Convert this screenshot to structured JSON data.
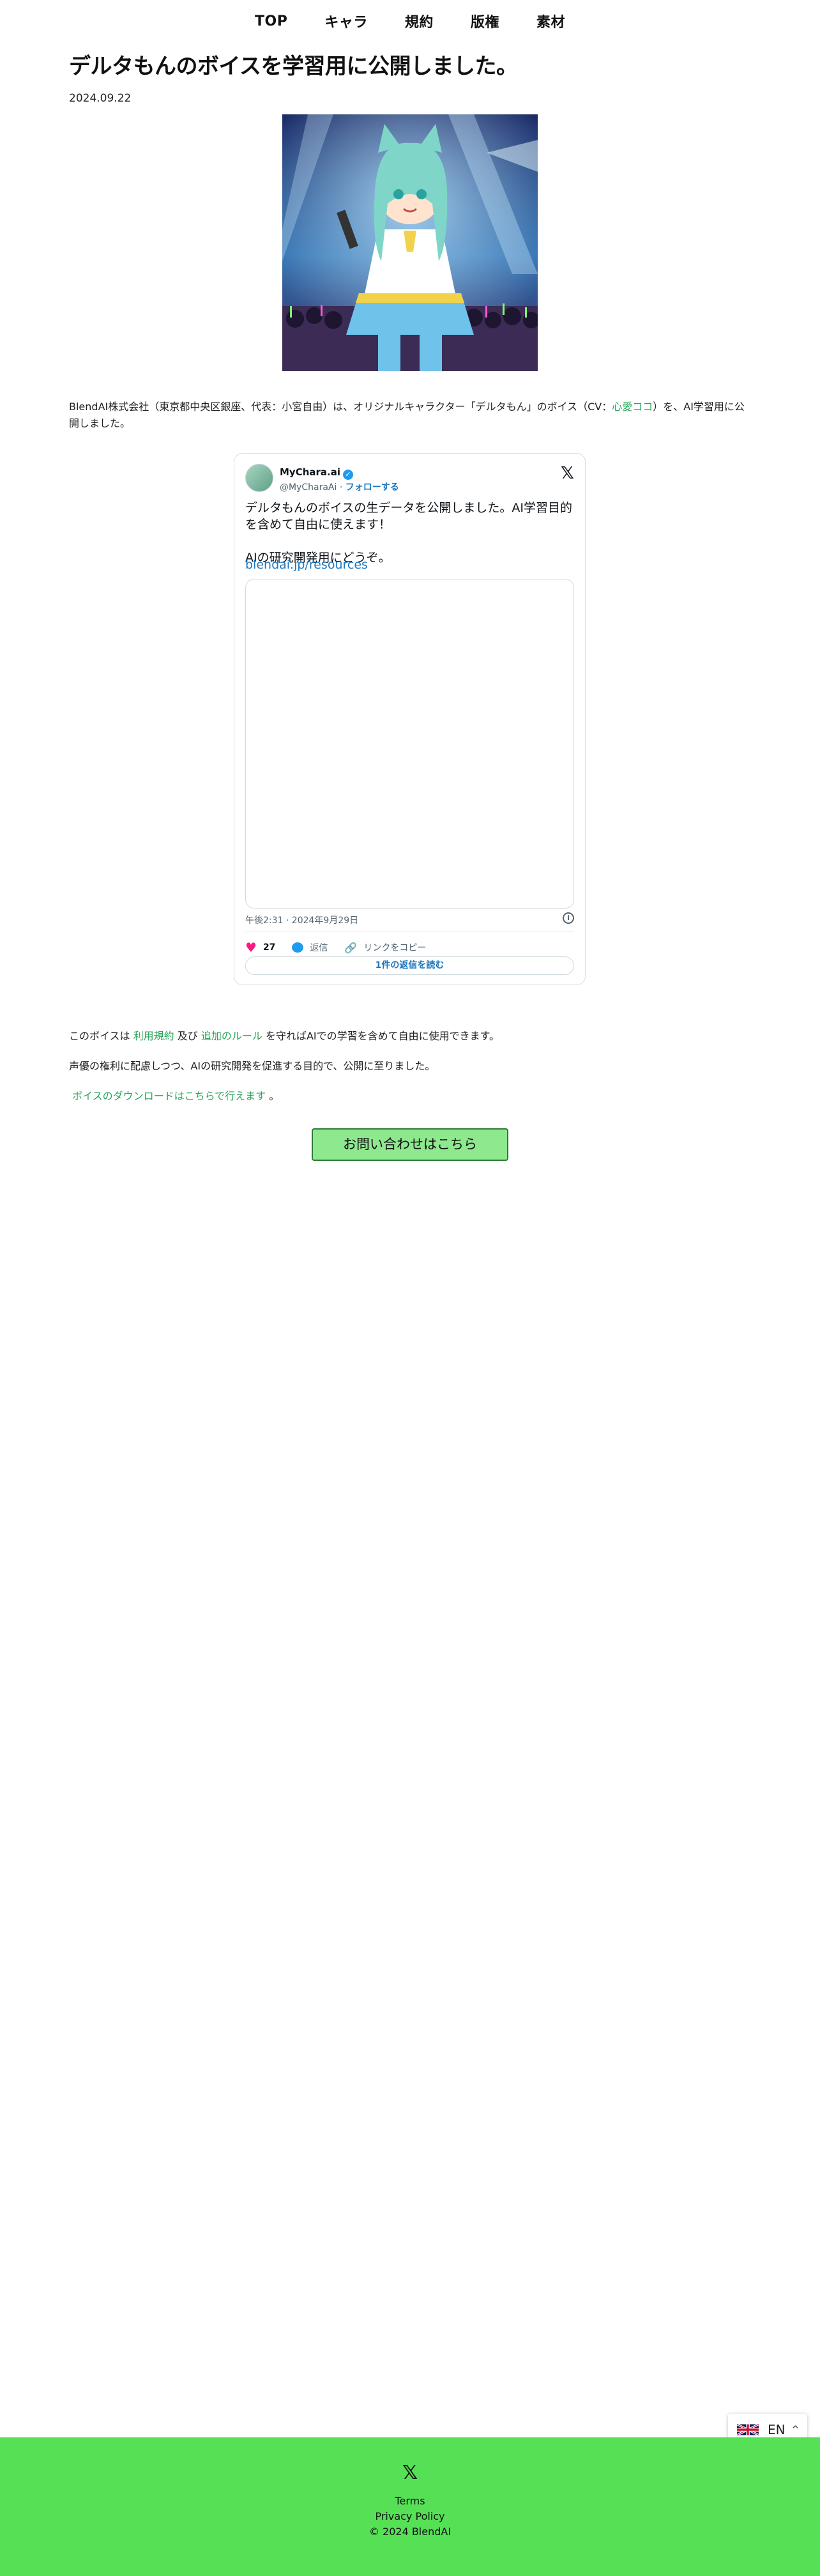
{
  "nav": {
    "items": [
      "TOP",
      "キャラ",
      "規約",
      "版権",
      "素材"
    ]
  },
  "article": {
    "title": "デルタもんのボイスを学習用に公開しました。",
    "date": "2024.09.22",
    "intro_before_link": "BlendAI株式会社（東京都中央区銀座、代表：小宮自由）は、オリジナルキャラクター「デルタもん」のボイス（CV：",
    "cv_link": "心愛ココ",
    "intro_after_link": "）を、AI学習用に公開しました。",
    "terms_prefix": "このボイスは",
    "terms_link": "利用規約",
    "terms_mid": "及び",
    "rules_link": "追加のルール",
    "terms_suffix": "を守ればAIでの学習を含めて自由に使用できます。",
    "purpose": "声優の権利に配慮しつつ、AIの研究開発を促進する目的で、公開に至りました。",
    "download_link": "ボイスのダウンロードはこちらで行えます",
    "download_suffix": "。",
    "contact_button": "お問い合わせはこちら"
  },
  "tweet": {
    "user_name": "MyChara.ai",
    "handle": "@MyCharaAi",
    "follow_label": "フォローする",
    "text": "デルタもんのボイスの生データを公開しました。AI学習目的を含めて自由に使えます！\n\nAIの研究開発用にどうぞ。",
    "link": "blendai.jp/resources",
    "timestamp": "午後2:31 · 2024年9月29日",
    "like_count": "27",
    "reply_label": "返信",
    "copy_link_label": "リンクをコピー",
    "read_replies_label": "1件の返信を読む"
  },
  "footer": {
    "terms": "Terms",
    "privacy": "Privacy Policy",
    "copyright": "© 2024 BlendAI"
  },
  "language": {
    "current": "EN"
  },
  "colors": {
    "link_green": "#2aa75a",
    "footer_green": "#55e055",
    "button_green": "#8ee88e",
    "tweet_blue": "#1d9bf0"
  }
}
